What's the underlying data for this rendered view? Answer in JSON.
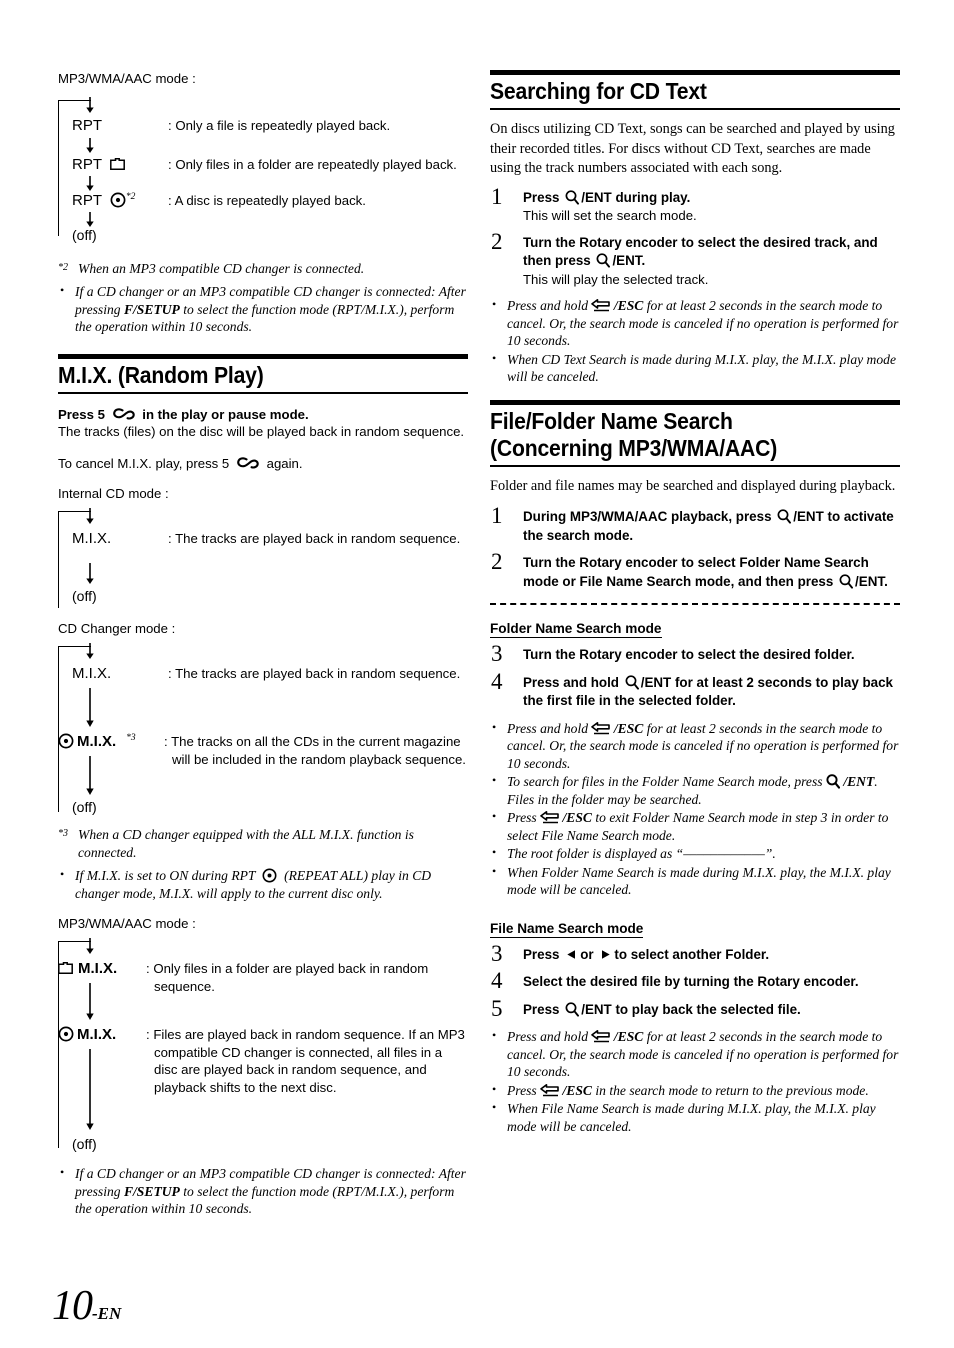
{
  "page": {
    "number": "10",
    "suffix": "-EN"
  },
  "left": {
    "rpt_mp3_label": "MP3/WMA/AAC mode :",
    "rpt_flow": [
      {
        "key": "RPT",
        "icon": "none",
        "sup": "",
        "desc": ": Only a file is repeatedly played back."
      },
      {
        "key": "RPT",
        "icon": "folder",
        "sup": "",
        "desc": ": Only files in a folder are repeatedly played back."
      },
      {
        "key": "RPT",
        "icon": "disc",
        "sup": "*2",
        "desc": ": A disc is repeatedly played back."
      },
      {
        "key": "(off)",
        "icon": "none",
        "sup": "",
        "desc": ""
      }
    ],
    "footnote2": {
      "mark": "*2",
      "text": "When an MP3 compatible CD changer is connected."
    },
    "note_setup_1": "If a CD changer or an MP3 compatible CD changer is connected: After pressing F/SETUP to select the function mode (RPT/M.I.X.), perform the operation within 10 seconds.",
    "note_setup_1_bold": "F/SETUP",
    "heading_mix": "M.I.X. (Random Play)",
    "mix_press_bold_pre": "Press 5",
    "mix_press_bold_post": "in the play or pause mode.",
    "mix_press_sub": "The tracks (files) on the disc will be played back in random sequence.",
    "mix_cancel_pre": "To cancel M.I.X. play, press 5",
    "mix_cancel_post": "again.",
    "internal_label": "Internal CD mode :",
    "internal_flow": [
      {
        "key": "M.I.X.",
        "icon": "none",
        "sup": "",
        "desc": ": The tracks are played back in random sequence."
      },
      {
        "key": "(off)",
        "icon": "none",
        "sup": "",
        "desc": ""
      }
    ],
    "changer_label": "CD Changer mode :",
    "changer_flow": [
      {
        "key": "M.I.X.",
        "icon": "none",
        "sup": "",
        "desc": ": The tracks are played back in random sequence."
      },
      {
        "key": "M.I.X.",
        "icon": "disc-lead",
        "sup": "*3",
        "desc": ": The tracks on all the CDs in the current magazine will be included in the random playback sequence."
      },
      {
        "key": "(off)",
        "icon": "none",
        "sup": "",
        "desc": ""
      }
    ],
    "footnote3": {
      "mark": "*3",
      "text": "When a CD changer equipped with the ALL M.I.X. function is connected."
    },
    "note_repeat_all_pre": "If M.I.X. is set to ON during RPT",
    "note_repeat_all_post": "(REPEAT ALL) play in CD changer mode, M.I.X. will apply to the current disc only.",
    "mp3_mix_label": "MP3/WMA/AAC mode :",
    "mp3_mix_flow": [
      {
        "key": "M.I.X.",
        "icon": "folder-lead",
        "sup": "",
        "desc": ": Only files in a folder are played back in random sequence."
      },
      {
        "key": "M.I.X.",
        "icon": "disc-lead",
        "sup": "",
        "desc": ": Files are played back in random sequence. If an MP3 compatible CD changer is connected, all files in a disc are played back in random sequence, and playback shifts to the next disc."
      },
      {
        "key": "(off)",
        "icon": "none",
        "sup": "",
        "desc": ""
      }
    ],
    "note_setup_2": "If a CD changer or an MP3 compatible CD changer is connected: After pressing F/SETUP to select the function mode (RPT/M.I.X.), perform the operation within 10 seconds.",
    "note_setup_2_bold": "F/SETUP"
  },
  "right": {
    "heading_cdtext": "Searching for CD Text",
    "cdtext_intro": "On discs utilizing CD Text, songs can be searched and played by using their recorded titles. For discs without CD Text, searches are made using the track numbers associated with each song.",
    "cdtext_steps": [
      {
        "num": "1",
        "head_pre": "Press",
        "head_mid": "/ENT",
        "head_post": "during play.",
        "sub": "This will set the search mode."
      },
      {
        "num": "2",
        "head_pre": "Turn the",
        "head_bold": "Rotary encoder",
        "head_mid": "to select the desired track, and then press",
        "head_icon_label": "/ENT.",
        "sub": "This will play the selected track."
      }
    ],
    "cdtext_notes": [
      "Press and hold  /ESC for at least 2 seconds in the search mode to cancel. Or, the search mode is canceled if no operation is performed for 10 seconds.",
      "When CD Text Search is made during M.I.X. play, the M.I.X. play mode will be canceled."
    ],
    "heading_ffsearch_line1": "File/Folder Name Search",
    "heading_ffsearch_line2": "(Concerning MP3/WMA/AAC)",
    "ffsearch_intro": "Folder and file names may be searched and displayed during playback.",
    "ffsearch_steps": [
      {
        "num": "1",
        "head_pre": "During MP3/WMA/AAC playback, press",
        "head_post": "/ENT to activate the search mode."
      },
      {
        "num": "2",
        "head_pre": "Turn the",
        "head_bold": "Rotary encoder",
        "head_mid": "to select Folder Name Search mode or File Name Search mode, and then press",
        "head_post": "/ENT."
      }
    ],
    "folder_mode_title": "Folder Name Search mode",
    "folder_steps": [
      {
        "num": "3",
        "head_pre": "Turn the",
        "head_bold": "Rotary encoder",
        "head_post": "to select the desired folder."
      },
      {
        "num": "4",
        "head_pre": "Press and hold",
        "head_post": "/ENT for at least 2 seconds to play back the first file in the selected folder."
      }
    ],
    "folder_notes": [
      "Press and hold  /ESC for at least 2 seconds in the search mode to cancel. Or, the search mode is canceled if no operation is performed for 10 seconds.",
      "To search for files in the Folder Name Search mode, press  /ENT. Files in the folder may be searched.",
      "Press  /ESC to exit Folder Name Search mode in step 3 in order to select File Name Search mode.",
      "The root folder is displayed as “––––––––––––”.",
      "When Folder Name Search is made during M.I.X. play, the M.I.X. play mode will be canceled."
    ],
    "file_mode_title": "File Name Search mode",
    "file_steps": [
      {
        "num": "3",
        "head_pre": "Press",
        "head_mid": "or",
        "head_post": "to select another Folder."
      },
      {
        "num": "4",
        "head_pre": "Select the desired file by turning the",
        "head_bold": "Rotary encoder."
      },
      {
        "num": "5",
        "head_pre": "Press",
        "head_post": "/ENT to play back the selected file."
      }
    ],
    "file_notes": [
      "Press and hold  /ESC for at least 2 seconds in the search mode to cancel. Or, the search mode is canceled if no operation is performed for 10 seconds.",
      "Press  /ESC in the search mode to return to the previous mode.",
      "When File Name Search is made during M.I.X. play, the M.I.X. play mode will be canceled."
    ]
  },
  "icons": {
    "folder": "folder-icon",
    "disc": "disc-icon",
    "magnifier": "magnifier-icon",
    "esc_arrow": "esc-back-arrow-icon",
    "mix_loop": "mix-loop-icon",
    "tri_left": "triangle-left-icon",
    "tri_right": "triangle-right-icon",
    "down_arrow": "down-arrow-icon"
  }
}
